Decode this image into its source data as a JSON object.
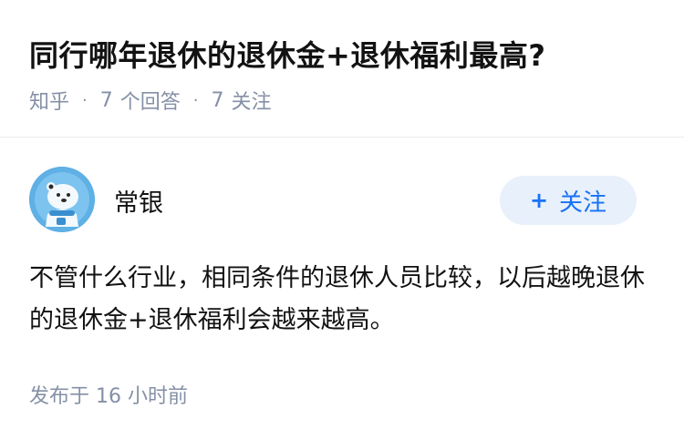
{
  "question": {
    "title": "同行哪年退休的退休金+退休福利最高?",
    "source": "知乎",
    "answer_count": "7",
    "answer_label": "个回答",
    "follower_count": "7",
    "follower_label": "关注"
  },
  "answer": {
    "author_name": "常银",
    "follow_plus": "+",
    "follow_label": "关注",
    "content": "不管什么行业，相同条件的退休人员比较，以后越晚退休的退休金+退休福利会越来越高。",
    "time_label": "发布于",
    "time_value": "16 小时前"
  },
  "colors": {
    "title": "#121212",
    "meta": "#8590a6",
    "accent": "#1772f6",
    "follow_bg": "#e8f0fb",
    "avatar_bg": "#5fb0e4"
  },
  "icons": {
    "avatar": "polar-bear-avatar-icon"
  }
}
